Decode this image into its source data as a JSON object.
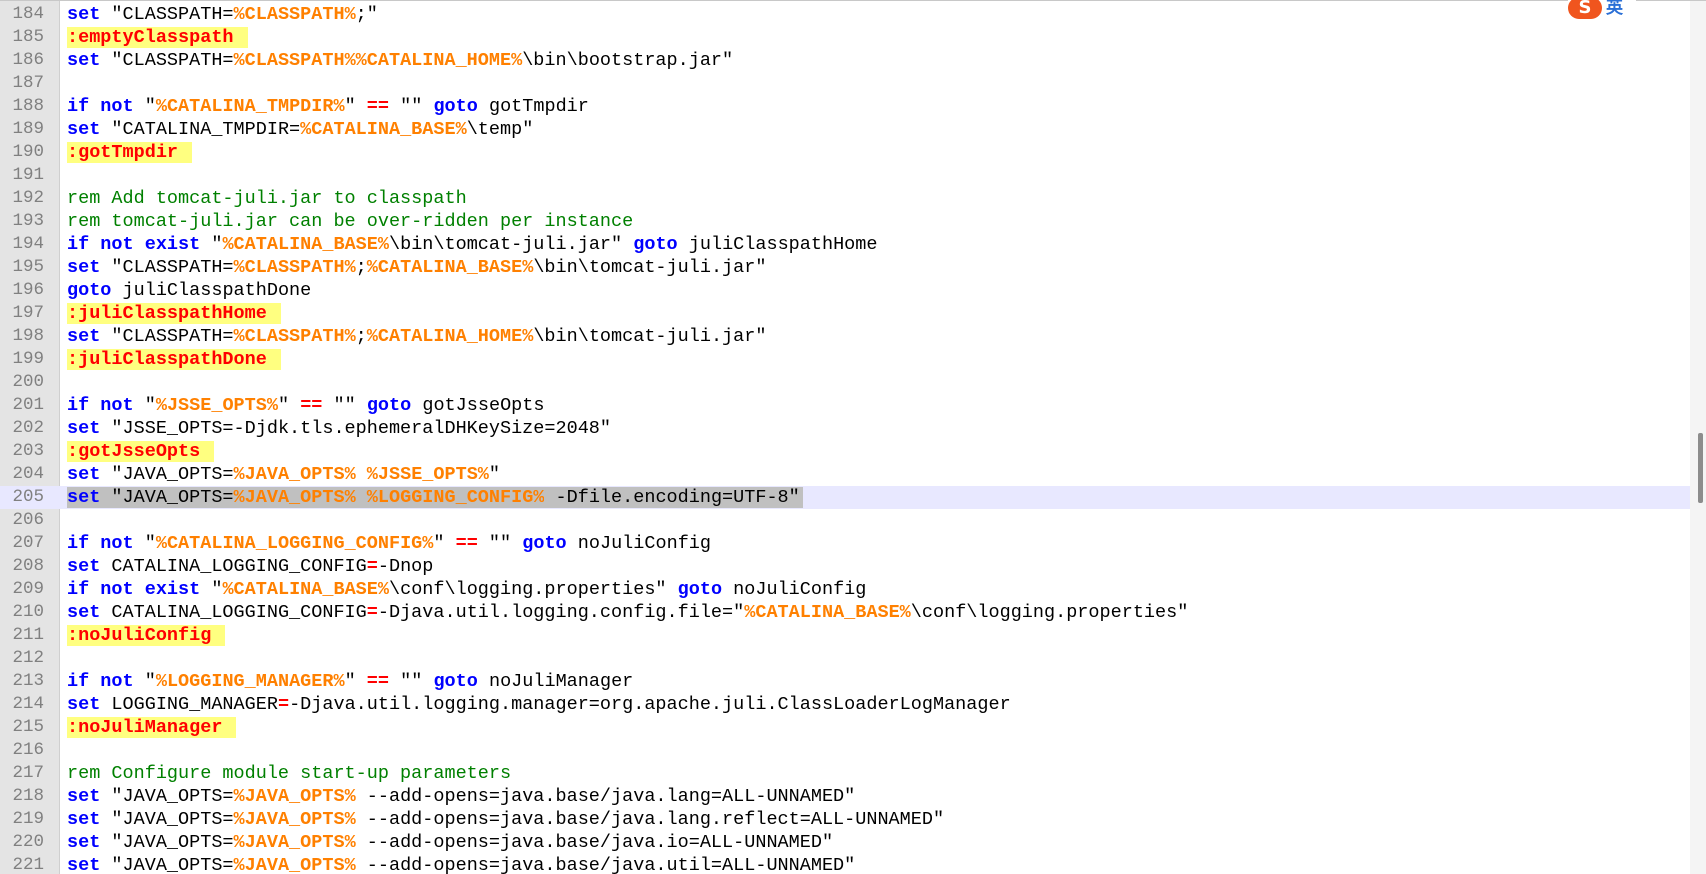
{
  "ime": {
    "logo": "S",
    "lang": "英"
  },
  "colors": {
    "keyword": "#0000ff",
    "variable": "#ff8000",
    "operator": "#ff0000",
    "comment": "#008000",
    "label_text": "#ff0000",
    "label_bg": "#ffff80",
    "current_line": "#e8e8ff",
    "selection": "#c0c0c0",
    "gutter": "#e4e4e4"
  },
  "editor": {
    "current_line": 205,
    "lines": [
      {
        "n": "184",
        "t": [
          [
            "kw",
            "set"
          ],
          [
            "txt",
            " \"CLASSPATH="
          ],
          [
            "var",
            "%CLASSPATH%"
          ],
          [
            "txt",
            ";\""
          ]
        ]
      },
      {
        "n": "185",
        "t": [
          [
            "lbl",
            ":emptyClasspath"
          ]
        ]
      },
      {
        "n": "186",
        "t": [
          [
            "kw",
            "set"
          ],
          [
            "txt",
            " \"CLASSPATH="
          ],
          [
            "var",
            "%CLASSPATH%%CATALINA_HOME%"
          ],
          [
            "txt",
            "\\bin\\bootstrap.jar\""
          ]
        ]
      },
      {
        "n": "187",
        "t": []
      },
      {
        "n": "188",
        "t": [
          [
            "kw",
            "if not"
          ],
          [
            "txt",
            " \""
          ],
          [
            "var",
            "%CATALINA_TMPDIR%"
          ],
          [
            "txt",
            "\" "
          ],
          [
            "op",
            "=="
          ],
          [
            "txt",
            " \"\" "
          ],
          [
            "kw",
            "goto"
          ],
          [
            "txt",
            " gotTmpdir"
          ]
        ]
      },
      {
        "n": "189",
        "t": [
          [
            "kw",
            "set"
          ],
          [
            "txt",
            " \"CATALINA_TMPDIR="
          ],
          [
            "var",
            "%CATALINA_BASE%"
          ],
          [
            "txt",
            "\\temp\""
          ]
        ]
      },
      {
        "n": "190",
        "t": [
          [
            "lbl",
            ":gotTmpdir"
          ]
        ]
      },
      {
        "n": "191",
        "t": []
      },
      {
        "n": "192",
        "t": [
          [
            "cm",
            "rem Add tomcat-juli.jar to classpath"
          ]
        ]
      },
      {
        "n": "193",
        "t": [
          [
            "cm",
            "rem tomcat-juli.jar can be over-ridden per instance"
          ]
        ]
      },
      {
        "n": "194",
        "t": [
          [
            "kw",
            "if not exist"
          ],
          [
            "txt",
            " \""
          ],
          [
            "var",
            "%CATALINA_BASE%"
          ],
          [
            "txt",
            "\\bin\\tomcat-juli.jar\" "
          ],
          [
            "kw",
            "goto"
          ],
          [
            "txt",
            " juliClasspathHome"
          ]
        ]
      },
      {
        "n": "195",
        "t": [
          [
            "kw",
            "set"
          ],
          [
            "txt",
            " \"CLASSPATH="
          ],
          [
            "var",
            "%CLASSPATH%"
          ],
          [
            "txt",
            ";"
          ],
          [
            "var",
            "%CATALINA_BASE%"
          ],
          [
            "txt",
            "\\bin\\tomcat-juli.jar\""
          ]
        ]
      },
      {
        "n": "196",
        "t": [
          [
            "kw",
            "goto"
          ],
          [
            "txt",
            " juliClasspathDone"
          ]
        ]
      },
      {
        "n": "197",
        "t": [
          [
            "lbl",
            ":juliClasspathHome"
          ]
        ]
      },
      {
        "n": "198",
        "t": [
          [
            "kw",
            "set"
          ],
          [
            "txt",
            " \"CLASSPATH="
          ],
          [
            "var",
            "%CLASSPATH%"
          ],
          [
            "txt",
            ";"
          ],
          [
            "var",
            "%CATALINA_HOME%"
          ],
          [
            "txt",
            "\\bin\\tomcat-juli.jar\""
          ]
        ]
      },
      {
        "n": "199",
        "t": [
          [
            "lbl",
            ":juliClasspathDone"
          ]
        ]
      },
      {
        "n": "200",
        "t": []
      },
      {
        "n": "201",
        "t": [
          [
            "kw",
            "if not"
          ],
          [
            "txt",
            " \""
          ],
          [
            "var",
            "%JSSE_OPTS%"
          ],
          [
            "txt",
            "\" "
          ],
          [
            "op",
            "=="
          ],
          [
            "txt",
            " \"\" "
          ],
          [
            "kw",
            "goto"
          ],
          [
            "txt",
            " gotJsseOpts"
          ]
        ]
      },
      {
        "n": "202",
        "t": [
          [
            "kw",
            "set"
          ],
          [
            "txt",
            " \"JSSE_OPTS=-Djdk.tls.ephemeralDHKeySize=2048\""
          ]
        ]
      },
      {
        "n": "203",
        "t": [
          [
            "lbl",
            ":gotJsseOpts"
          ]
        ]
      },
      {
        "n": "204",
        "t": [
          [
            "kw",
            "set"
          ],
          [
            "txt",
            " \"JAVA_OPTS="
          ],
          [
            "var",
            "%JAVA_OPTS%"
          ],
          [
            "txt",
            " "
          ],
          [
            "var",
            "%JSSE_OPTS%"
          ],
          [
            "txt",
            "\""
          ]
        ]
      },
      {
        "n": "205",
        "t": [
          [
            "kw",
            "set"
          ],
          [
            "txt",
            " \"JAVA_OPTS="
          ],
          [
            "var",
            "%JAVA_OPTS%"
          ],
          [
            "txt",
            " "
          ],
          [
            "var",
            "%LOGGING_CONFIG%"
          ],
          [
            "txt",
            " -Dfile.encoding=UTF-8\""
          ]
        ]
      },
      {
        "n": "206",
        "t": []
      },
      {
        "n": "207",
        "t": [
          [
            "kw",
            "if not"
          ],
          [
            "txt",
            " \""
          ],
          [
            "var",
            "%CATALINA_LOGGING_CONFIG%"
          ],
          [
            "txt",
            "\" "
          ],
          [
            "op",
            "=="
          ],
          [
            "txt",
            " \"\" "
          ],
          [
            "kw",
            "goto"
          ],
          [
            "txt",
            " noJuliConfig"
          ]
        ]
      },
      {
        "n": "208",
        "t": [
          [
            "kw",
            "set"
          ],
          [
            "txt",
            " CATALINA_LOGGING_CONFIG"
          ],
          [
            "op",
            "="
          ],
          [
            "txt",
            "-Dnop"
          ]
        ]
      },
      {
        "n": "209",
        "t": [
          [
            "kw",
            "if not exist"
          ],
          [
            "txt",
            " \""
          ],
          [
            "var",
            "%CATALINA_BASE%"
          ],
          [
            "txt",
            "\\conf\\logging.properties\" "
          ],
          [
            "kw",
            "goto"
          ],
          [
            "txt",
            " noJuliConfig"
          ]
        ]
      },
      {
        "n": "210",
        "t": [
          [
            "kw",
            "set"
          ],
          [
            "txt",
            " CATALINA_LOGGING_CONFIG"
          ],
          [
            "op",
            "="
          ],
          [
            "txt",
            "-Djava.util.logging.config.file=\""
          ],
          [
            "var",
            "%CATALINA_BASE%"
          ],
          [
            "txt",
            "\\conf\\logging.properties\""
          ]
        ]
      },
      {
        "n": "211",
        "t": [
          [
            "lbl",
            ":noJuliConfig"
          ]
        ]
      },
      {
        "n": "212",
        "t": []
      },
      {
        "n": "213",
        "t": [
          [
            "kw",
            "if not"
          ],
          [
            "txt",
            " \""
          ],
          [
            "var",
            "%LOGGING_MANAGER%"
          ],
          [
            "txt",
            "\" "
          ],
          [
            "op",
            "=="
          ],
          [
            "txt",
            " \"\" "
          ],
          [
            "kw",
            "goto"
          ],
          [
            "txt",
            " noJuliManager"
          ]
        ]
      },
      {
        "n": "214",
        "t": [
          [
            "kw",
            "set"
          ],
          [
            "txt",
            " LOGGING_MANAGER"
          ],
          [
            "op",
            "="
          ],
          [
            "txt",
            "-Djava.util.logging.manager=org.apache.juli.ClassLoaderLogManager"
          ]
        ]
      },
      {
        "n": "215",
        "t": [
          [
            "lbl",
            ":noJuliManager"
          ]
        ]
      },
      {
        "n": "216",
        "t": []
      },
      {
        "n": "217",
        "t": [
          [
            "cm",
            "rem Configure module start-up parameters"
          ]
        ]
      },
      {
        "n": "218",
        "t": [
          [
            "kw",
            "set"
          ],
          [
            "txt",
            " \"JAVA_OPTS="
          ],
          [
            "var",
            "%JAVA_OPTS%"
          ],
          [
            "txt",
            " --add-opens=java.base/java.lang=ALL-UNNAMED\""
          ]
        ]
      },
      {
        "n": "219",
        "t": [
          [
            "kw",
            "set"
          ],
          [
            "txt",
            " \"JAVA_OPTS="
          ],
          [
            "var",
            "%JAVA_OPTS%"
          ],
          [
            "txt",
            " --add-opens=java.base/java.lang.reflect=ALL-UNNAMED\""
          ]
        ]
      },
      {
        "n": "220",
        "t": [
          [
            "kw",
            "set"
          ],
          [
            "txt",
            " \"JAVA_OPTS="
          ],
          [
            "var",
            "%JAVA_OPTS%"
          ],
          [
            "txt",
            " --add-opens=java.base/java.io=ALL-UNNAMED\""
          ]
        ]
      },
      {
        "n": "221",
        "t": [
          [
            "kw",
            "set"
          ],
          [
            "txt",
            " \"JAVA_OPTS="
          ],
          [
            "var",
            "%JAVA_OPTS%"
          ],
          [
            "txt",
            " --add-opens=java.base/java.util=ALL-UNNAMED\""
          ]
        ]
      }
    ]
  }
}
